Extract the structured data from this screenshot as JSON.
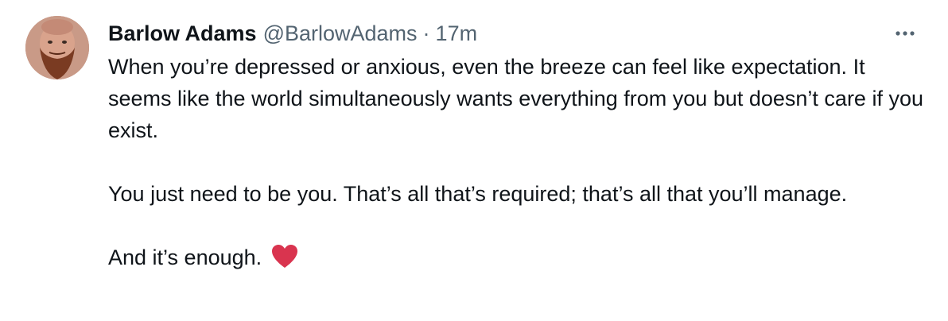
{
  "tweet": {
    "author": {
      "display_name": "Barlow Adams",
      "handle": "@BarlowAdams"
    },
    "separator": "·",
    "timestamp": "17m",
    "more_icon": "more-horizontal-icon",
    "paragraphs": [
      "When you’re depressed or anxious, even the breeze can feel like expectation. It seems like the world simultaneously wants everything from you but doesn’t care if you exist.",
      "You just need to be you. That’s all that’s required; that’s all that you’ll manage.",
      "And it’s enough."
    ],
    "emoji": "red-heart-icon"
  },
  "colors": {
    "text_primary": "#0f1419",
    "text_secondary": "#536471",
    "heart": "#d9344f"
  }
}
